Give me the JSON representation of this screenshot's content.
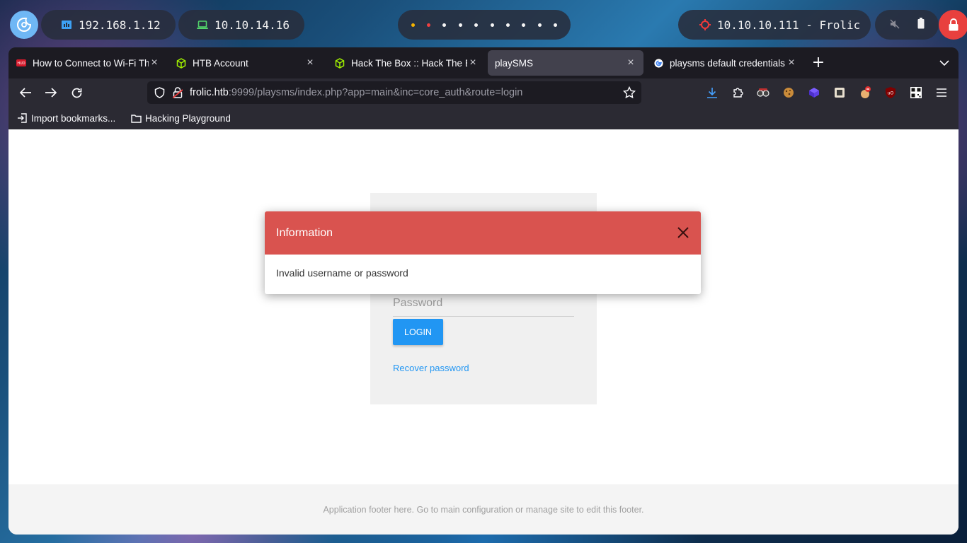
{
  "panel": {
    "local_ip": "192.168.1.12",
    "vpn_ip": "10.10.14.16",
    "target": "10.10.10.111 - Frolic",
    "workspaces": [
      "yellow",
      "red",
      "white",
      "white",
      "white",
      "white",
      "white",
      "white",
      "white",
      "white"
    ]
  },
  "browser": {
    "tabs": [
      {
        "title": "How to Connect to Wi-Fi Through"
      },
      {
        "title": "HTB Account"
      },
      {
        "title": "Hack The Box :: Hack The Box"
      },
      {
        "title": "playSMS"
      },
      {
        "title": "playsms default credentials"
      }
    ],
    "url_host": "frolic.htb",
    "url_rest": ":9999/playsms/index.php?app=main&inc=core_auth&route=login",
    "bookmarks": {
      "import": "Import bookmarks...",
      "folder": "Hacking Playground"
    }
  },
  "login": {
    "password_placeholder": "Password",
    "login_button": "LOGIN",
    "recover_link": "Recover password"
  },
  "modal": {
    "title": "Information",
    "message": "Invalid username or password"
  },
  "footer": {
    "text": "Application footer here. Go to main configuration or manage site to edit this footer."
  },
  "colors": {
    "modal_header": "#d9534f",
    "primary": "#2196f3",
    "lock": "#e8403e"
  }
}
